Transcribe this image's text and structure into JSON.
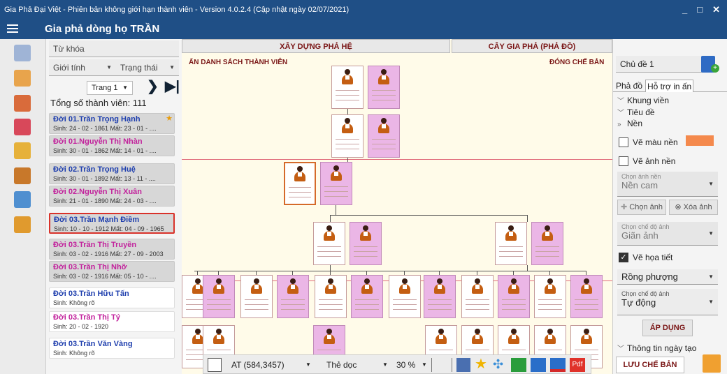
{
  "window": {
    "title": "Gia Phả Đại Việt - Phiên bản không giới hạn thành viên - Version 4.0.2.4 (Cập nhật ngày 02/07/2021)",
    "minimize": "_",
    "maximize": "□",
    "close": "✕"
  },
  "header": {
    "title": "Gia phả dòng họ TRẦN"
  },
  "sidebar_icons": [
    "family-tree-icon",
    "calendar-tree-icon",
    "people-icon",
    "calendar-grid-icon",
    "gear-settings-icon",
    "person-search-icon",
    "computer-time-icon",
    "lock-table-icon"
  ],
  "filter": {
    "keyword_placeholder": "Từ khóa",
    "gender": "Giới tính",
    "status": "Trạng thái",
    "page": "Trang 1",
    "total_label": "Tổng số thành viên: 111"
  },
  "members": [
    {
      "name": "Đời 01.Trần Trọng Hạnh",
      "dates": "Sinh: 24 - 02 - 1861   Mất: 23 - 01 - ....",
      "g": "male",
      "bg": "grey"
    },
    {
      "name": "Đời 01.Nguyễn Thị Nhàn",
      "dates": "Sinh: 30 - 01 - 1862   Mất: 14 - 01 - ....",
      "g": "female",
      "bg": "grey"
    },
    {
      "name": "Đời 02.Trần Trọng Huệ",
      "dates": "Sinh: 30 - 01 - 1892   Mất: 13 - 11 - ....",
      "g": "male",
      "bg": "grey"
    },
    {
      "name": "Đời 02.Nguyễn Thị Xuân",
      "dates": "Sinh: 21 - 01 - 1890   Mất: 24 - 03 - ....",
      "g": "female",
      "bg": "grey"
    },
    {
      "name": "Đời 03.Trần Mạnh Điềm",
      "dates": "Sinh: 10 - 10 - 1912   Mất: 04 - 09 - 1965",
      "g": "male",
      "bg": "grey",
      "selected": true
    },
    {
      "name": "Đời 03.Trần Thị Truyền",
      "dates": "Sinh: 03 - 02 - 1916   Mất: 27 - 09 - 2003",
      "g": "female",
      "bg": "grey"
    },
    {
      "name": "Đời 03.Trần Thị Nhỡ",
      "dates": "Sinh: 03 - 02 - 1916   Mất: 05 - 10 - ....",
      "g": "female",
      "bg": "grey"
    },
    {
      "name": "Đời 03.Trần Hữu Tấn",
      "dates": "Sinh: Không rõ",
      "g": "male",
      "bg": "white"
    },
    {
      "name": "Đời 03.Trần Thị Tý",
      "dates": "Sinh: 20 - 02 - 1920",
      "g": "female",
      "bg": "white"
    },
    {
      "name": "Đời 03.Trần Văn Vàng",
      "dates": "Sinh: Không rõ",
      "g": "male",
      "bg": "white"
    }
  ],
  "tabs": {
    "build": "XÂY DỰNG PHẢ HỆ",
    "tree": "CÂY GIA PHẢ (PHẢ ĐỒ)"
  },
  "canvas": {
    "hide_list": "ẨN DANH SÁCH THÀNH VIÊN",
    "close_mode": "ĐÓNG CHẾ BẢN"
  },
  "toolbar": {
    "position": "AT (584,3457)",
    "orientation": "Thẻ dọc",
    "zoom": "30 %",
    "pdf": "Pdf"
  },
  "right": {
    "theme": "Chủ đề 1",
    "tab_pha_do": "Phả đồ",
    "tab_print": "Hỗ trợ in ấn",
    "sec_frame": "Khung viền",
    "sec_title": "Tiêu đề",
    "sec_bg": "Nền",
    "bg_color_label": "Vẽ màu nền",
    "bg_color": "#f4894c",
    "bg_image_label": "Vẽ ảnh nền",
    "bg_image_select_label": "Chọn ảnh nền",
    "bg_image_select_value": "Nền cam",
    "pick_image": "Chọn ảnh",
    "delete_image": "Xóa ảnh",
    "image_mode_label": "Chọn chế độ ảnh",
    "image_mode_value": "Giãn ảnh",
    "pattern_label": "Vẽ họa tiết",
    "pattern_value": "Rồng phượng",
    "mode2_label": "Chọn chế độ ảnh",
    "mode2_value": "Tự động",
    "apply": "ÁP DỤNG",
    "date_info": "Thông tin ngày tạo",
    "save": "LƯU CHẾ BẢN"
  }
}
